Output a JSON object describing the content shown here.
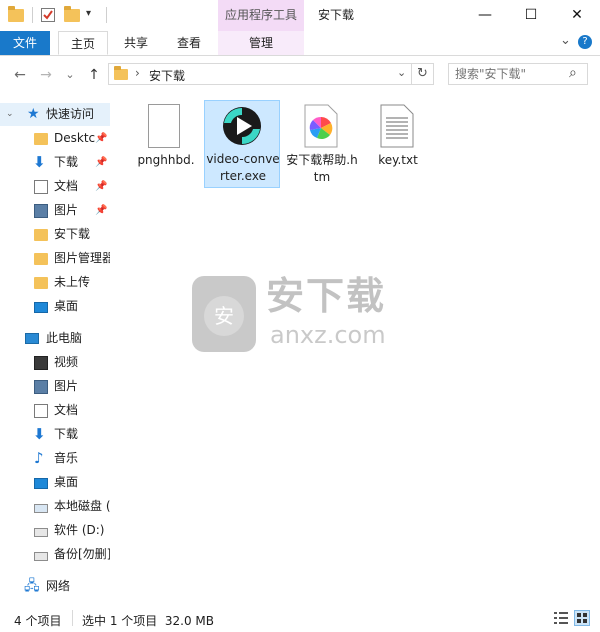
{
  "titlebar": {
    "context_tab": "应用程序工具",
    "window_title": "安下载",
    "minimize": "—",
    "maximize": "☐",
    "close": "✕"
  },
  "ribbon": {
    "tabs": [
      {
        "label": "文件"
      },
      {
        "label": "主页"
      },
      {
        "label": "共享"
      },
      {
        "label": "查看"
      },
      {
        "label": "管理"
      }
    ],
    "collapse": "⌄",
    "help": "?"
  },
  "nav": {
    "back": "←",
    "forward": "→",
    "recent": "⌄",
    "up": "↑",
    "address": "安下载",
    "address_sep": "›",
    "dropdown": "⌄",
    "refresh": "↻",
    "search_placeholder": "搜索\"安下载\"",
    "search_icon": "⌕"
  },
  "sidebar": {
    "quick_access": "快速访问",
    "quick_items": [
      {
        "label": "Desktc",
        "icon": "folder-icon",
        "pinned": true
      },
      {
        "label": "下载",
        "icon": "download-icon",
        "pinned": true
      },
      {
        "label": "文档",
        "icon": "document-icon",
        "pinned": true
      },
      {
        "label": "图片",
        "icon": "pictures-icon",
        "pinned": true
      },
      {
        "label": "安下载",
        "icon": "folder-icon",
        "pinned": false
      },
      {
        "label": "图片管理器",
        "icon": "folder-icon",
        "pinned": false
      },
      {
        "label": "未上传",
        "icon": "folder-icon",
        "pinned": false
      },
      {
        "label": "桌面",
        "icon": "desktop-icon",
        "pinned": false
      }
    ],
    "this_pc": "此电脑",
    "pc_items": [
      {
        "label": "视频",
        "icon": "video-icon"
      },
      {
        "label": "图片",
        "icon": "pictures-icon"
      },
      {
        "label": "文档",
        "icon": "document-icon"
      },
      {
        "label": "下载",
        "icon": "download-icon"
      },
      {
        "label": "音乐",
        "icon": "music-icon"
      },
      {
        "label": "桌面",
        "icon": "desktop-icon"
      },
      {
        "label": "本地磁盘 (",
        "icon": "local-disk-icon"
      },
      {
        "label": "软件 (D:)",
        "icon": "drive-icon"
      },
      {
        "label": "备份[勿删]",
        "icon": "drive-icon"
      }
    ],
    "network": "网络"
  },
  "files": [
    {
      "name": "pnghhbd.",
      "icon": "blank-file-icon"
    },
    {
      "name": "video-converter.exe",
      "icon": "video-converter-icon",
      "selected": true
    },
    {
      "name": "安下载帮助.htm",
      "icon": "colorful-htm-icon"
    },
    {
      "name": "key.txt",
      "icon": "text-file-icon"
    }
  ],
  "watermark": {
    "text": "安下载",
    "sub": "anxz.com",
    "badge": "安"
  },
  "status": {
    "count": "4 个项目",
    "selection": "选中 1 个项目  32.0 MB"
  }
}
